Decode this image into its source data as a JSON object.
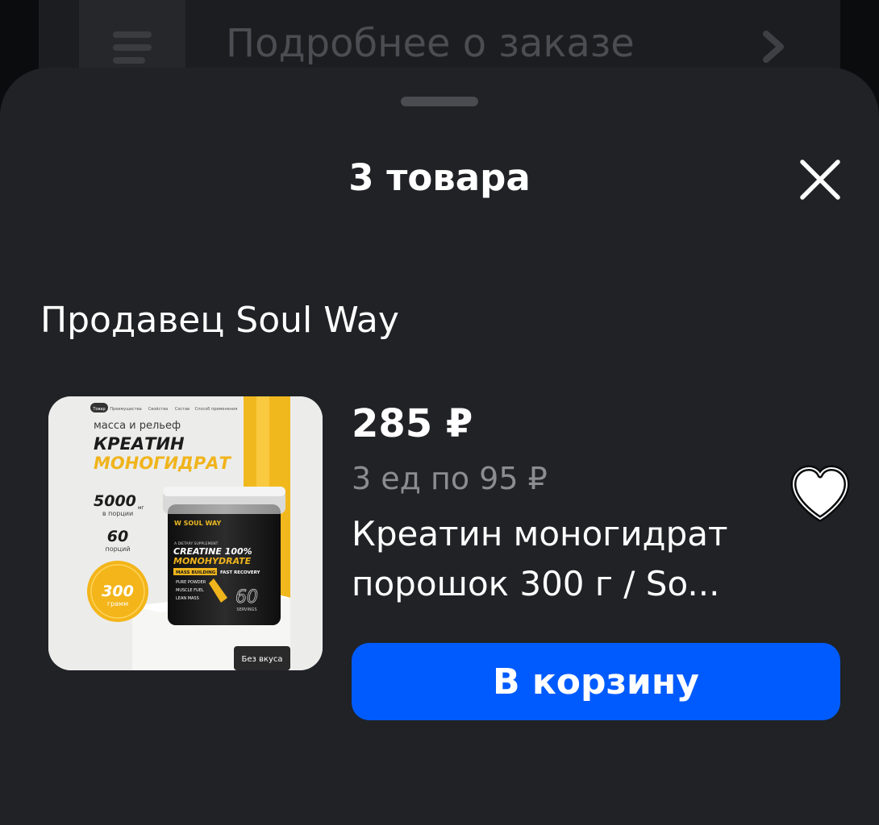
{
  "backdrop": {
    "title": "Подробнее о заказе"
  },
  "sheet": {
    "title": "3 товара"
  },
  "seller": {
    "label": "Продавец Soul Way"
  },
  "product": {
    "price": "285 ₽",
    "unit_price": "3 ед по 95 ₽",
    "title": "Креатин моногидрат порошок 300 г / So...",
    "image": {
      "tabs": [
        "Товар",
        "Преимущества",
        "Свойства",
        "Состав",
        "Способ применения"
      ],
      "tagline": "масса и рельеф",
      "heading_1": "КРЕАТИН",
      "heading_2": "МОНОГИДРАТ",
      "dose_value": "5000",
      "dose_unit": "мг",
      "dose_caption": "в порции",
      "servings_value": "60",
      "servings_caption": "порций",
      "weight_value": "300",
      "weight_caption": "грамм",
      "jar_brand": "W SOUL WAY",
      "jar_supplement": "A DIETARY SUPPLEMENT",
      "jar_line_1": "CREATINE 100%",
      "jar_line_2": "MONOHYDRATE",
      "jar_band_1": "MASS BUILDING",
      "jar_band_2": "FAST RECOVERY",
      "jar_feature_1": "PURE POWDER",
      "jar_feature_2": "MUSCLE FUEL",
      "jar_feature_3": "LEAN MASS",
      "jar_servings": "60",
      "jar_servings_label": "SERVINGS",
      "flavor": "Без вкуса"
    }
  },
  "actions": {
    "add_to_cart": "В корзину"
  },
  "colors": {
    "sheet_bg": "#202226",
    "accent": "#005bff",
    "muted_text": "#8b8d92",
    "gold": "#f0b41c"
  },
  "icons": {
    "menu": "menu-icon",
    "chevron": "chevron-right-icon",
    "close": "close-icon",
    "favorite": "heart-icon"
  }
}
